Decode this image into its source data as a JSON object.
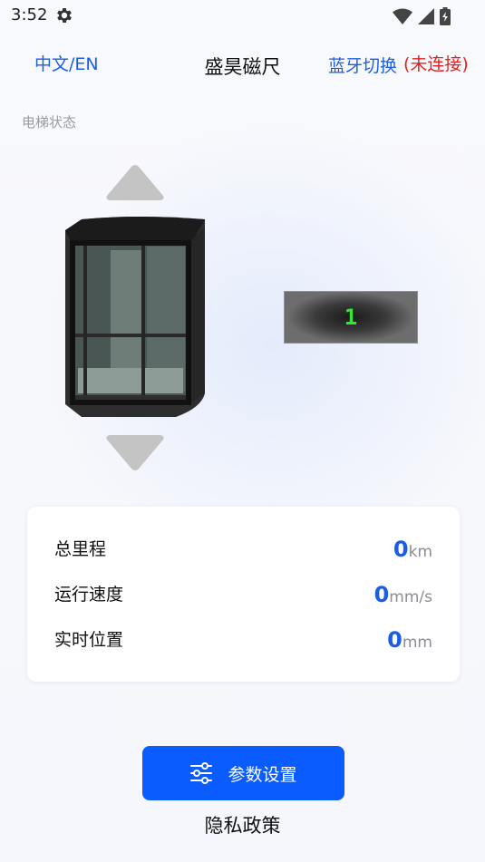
{
  "status_bar": {
    "time": "3:52",
    "icons": [
      "gear-icon",
      "wifi-icon",
      "cell-signal-icon",
      "battery-charging-icon"
    ]
  },
  "header": {
    "language_toggle": "中文/EN",
    "title": "盛昊磁尺",
    "bluetooth_toggle": "蓝牙切换",
    "bluetooth_status": "(未连接)"
  },
  "elevator_section": {
    "label": "电梯状态",
    "current_floor": "1",
    "icons": [
      "up-arrow-icon",
      "elevator-car-icon",
      "down-arrow-icon"
    ]
  },
  "stats": [
    {
      "label": "总里程",
      "value": "0",
      "unit": "km"
    },
    {
      "label": "运行速度",
      "value": "0",
      "unit": "mm/s"
    },
    {
      "label": "实时位置",
      "value": "0",
      "unit": "mm"
    }
  ],
  "actions": {
    "settings_button": "参数设置",
    "settings_icon": "sliders-icon",
    "privacy_link": "隐私政策"
  },
  "colors": {
    "accent": "#1a5ee8",
    "button": "#0b5cff",
    "error": "#e32020",
    "floor_digit": "#33e633"
  }
}
